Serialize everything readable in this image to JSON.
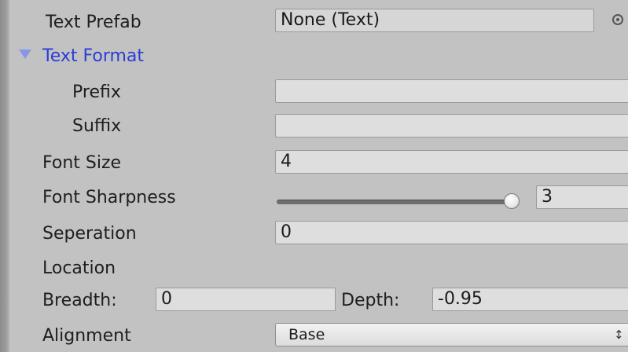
{
  "inspector": {
    "text_prefab": {
      "label": "Text Prefab",
      "value": "None (Text)"
    },
    "text_format": {
      "label": "Text Format",
      "prefix": {
        "label": "Prefix",
        "value": ""
      },
      "suffix": {
        "label": "Suffix",
        "value": ""
      }
    },
    "font_size": {
      "label": "Font Size",
      "value": "4"
    },
    "font_sharpness": {
      "label": "Font Sharpness",
      "value": "3",
      "slider_fraction": 0.98
    },
    "seperation": {
      "label": "Seperation",
      "value": "0"
    },
    "location": {
      "label": "Location",
      "breadth": {
        "label": "Breadth:",
        "value": "0"
      },
      "depth": {
        "label": "Depth:",
        "value": "-0.95"
      }
    },
    "alignment": {
      "label": "Alignment",
      "value": "Base",
      "arrow_glyph": "↕"
    }
  },
  "icons": {
    "object_picker": "object-picker-icon",
    "foldout": "foldout-expanded-icon"
  },
  "colors": {
    "panel_background": "#c2c2c2",
    "field_background": "#dedede",
    "foldout_label": "#2b3dd6"
  }
}
